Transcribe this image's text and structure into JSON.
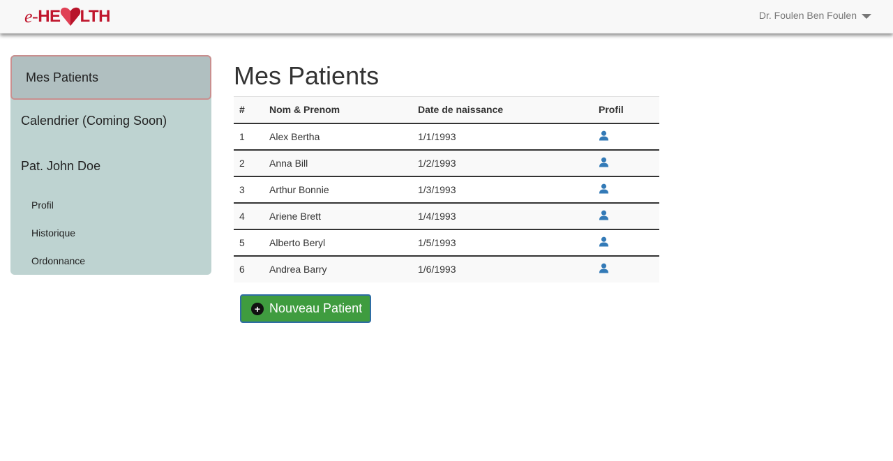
{
  "navbar": {
    "brand_e": "e-",
    "brand_he": "HE",
    "brand_lth": "LTH",
    "user": "Dr. Foulen Ben Foulen"
  },
  "sidebar": {
    "active": "Mes Patients",
    "calendar": "Calendrier (Coming Soon)",
    "patient": "Pat. John Doe",
    "sub_items": [
      "Profil",
      "Historique",
      "Ordonnance"
    ]
  },
  "main": {
    "title": "Mes Patients",
    "columns": [
      "#",
      "Nom & Prenom",
      "Date de naissance",
      "Profil"
    ],
    "rows": [
      {
        "num": "1",
        "name": "Alex Bertha",
        "dob": "1/1/1993"
      },
      {
        "num": "2",
        "name": "Anna Bill",
        "dob": "1/2/1993"
      },
      {
        "num": "3",
        "name": "Arthur Bonnie",
        "dob": "1/3/1993"
      },
      {
        "num": "4",
        "name": "Ariene Brett",
        "dob": "1/4/1993"
      },
      {
        "num": "5",
        "name": "Alberto Beryl",
        "dob": "1/5/1993"
      },
      {
        "num": "6",
        "name": "Andrea Barry",
        "dob": "1/6/1993"
      }
    ],
    "new_button": "Nouveau Patient"
  },
  "colors": {
    "brand": "#c0162d",
    "sidebar": "#bed3d1",
    "button": "#3f9c3f",
    "profile_icon": "#337ab7"
  },
  "icons": {
    "logo_heart": "heart-icon",
    "profile": "user-icon",
    "dropdown": "caret-down-icon",
    "add": "plus-circle-icon"
  }
}
